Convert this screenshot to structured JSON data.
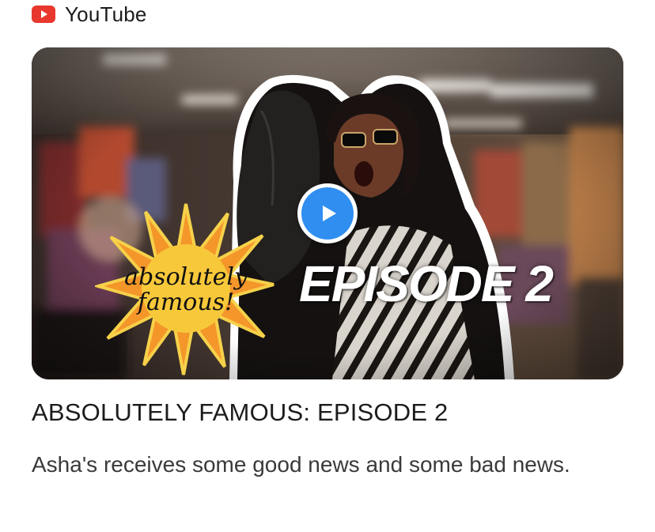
{
  "source": {
    "name": "YouTube",
    "icon": "youtube-logo-icon",
    "icon_color": "#e8372d"
  },
  "thumbnail": {
    "logo_line1": "absolutely",
    "logo_line2": "famous!",
    "overlay_text": "EPISODE 2",
    "play_icon": "play-icon",
    "play_color": "#2f8ef0",
    "burst_color": "#f4962a"
  },
  "video": {
    "title": "ABSOLUTELY FAMOUS: EPISODE 2",
    "description": "Asha's receives some good news and some bad news."
  }
}
